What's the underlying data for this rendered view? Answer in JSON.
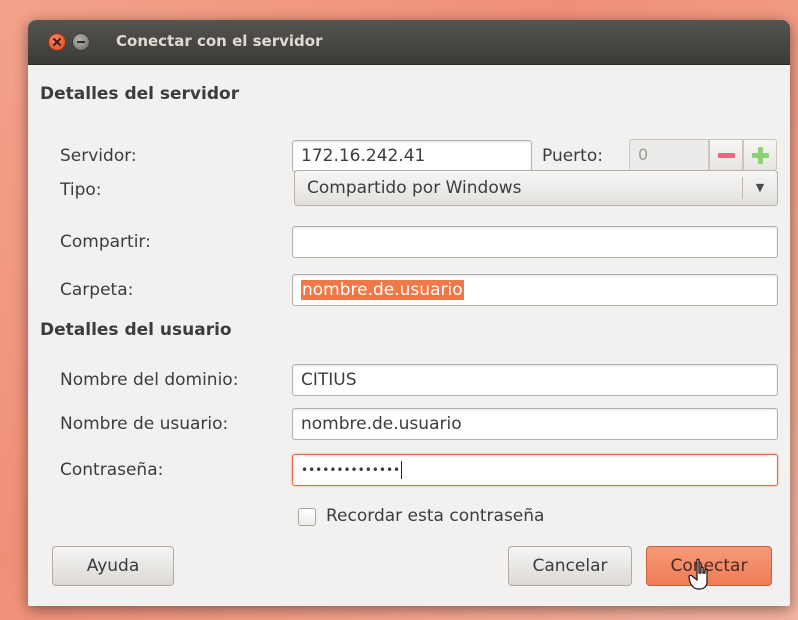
{
  "window": {
    "title": "Conectar con el servidor"
  },
  "server_details": {
    "heading": "Detalles del servidor",
    "server_label": "Servidor:",
    "server_value": "172.16.242.41",
    "port_label": "Puerto:",
    "port_value": "0",
    "type_label": "Tipo:",
    "type_value": "Compartido por Windows",
    "share_label": "Compartir:",
    "share_value": "",
    "folder_label": "Carpeta:",
    "folder_value": "nombre.de.usuario"
  },
  "user_details": {
    "heading": "Detalles del usuario",
    "domain_label": "Nombre del dominio:",
    "domain_value": "CITIUS",
    "username_label": "Nombre de usuario:",
    "username_value": "nombre.de.usuario",
    "password_label": "Contraseña:",
    "password_value": "••••••••••••••"
  },
  "remember": {
    "label": "Recordar esta contraseña",
    "checked": false
  },
  "buttons": {
    "help": "Ayuda",
    "cancel": "Cancelar",
    "connect": "Conectar"
  },
  "colors": {
    "accent": "#f07746",
    "titlebar": "#3c3b37",
    "window_bg": "#f2f1f0"
  },
  "icons": {
    "close": "close-icon",
    "minimize": "minimize-icon",
    "spin_minus": "minus-icon",
    "spin_plus": "plus-icon",
    "combo_arrow": "chevron-down-icon",
    "cursor": "mouse-pointer-icon"
  }
}
